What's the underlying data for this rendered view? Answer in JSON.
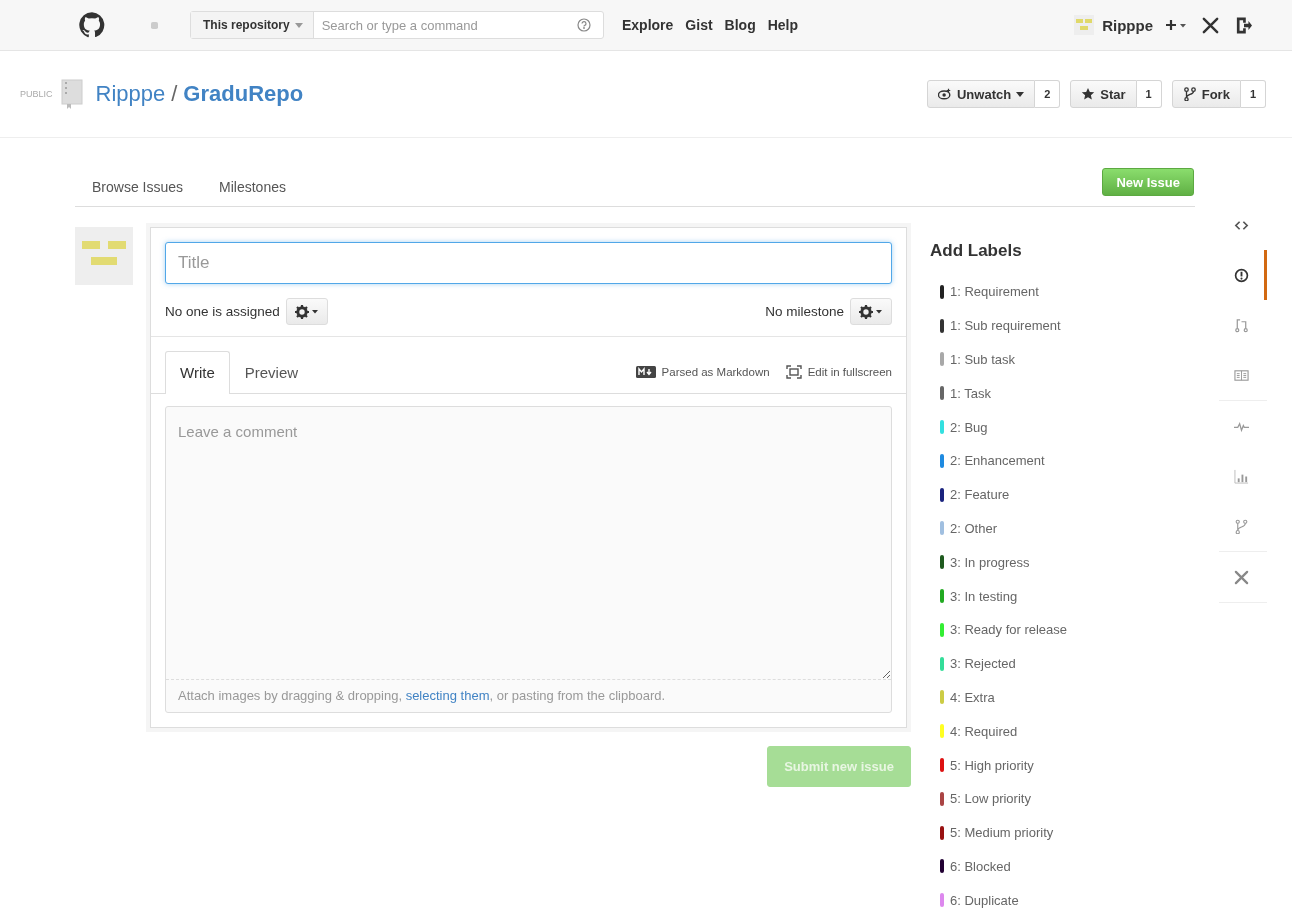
{
  "header": {
    "scope": "This repository",
    "search_placeholder": "Search or type a command",
    "nav": [
      "Explore",
      "Gist",
      "Blog",
      "Help"
    ],
    "user": "Ripppe"
  },
  "repo": {
    "visibility": "PUBLIC",
    "owner": "Ripppe",
    "separator": "/",
    "name": "GraduRepo",
    "actions": [
      {
        "kind": "watch",
        "label": "Unwatch",
        "count": "2"
      },
      {
        "kind": "star",
        "label": "Star",
        "count": "1"
      },
      {
        "kind": "fork",
        "label": "Fork",
        "count": "1"
      }
    ]
  },
  "subnav": {
    "links": [
      "Browse Issues",
      "Milestones"
    ],
    "new_button": "New Issue"
  },
  "form": {
    "title_placeholder": "Title",
    "assignee": "No one is assigned",
    "milestone": "No milestone",
    "tabs": [
      {
        "label": "Write",
        "selected": true
      },
      {
        "label": "Preview",
        "selected": false
      }
    ],
    "markdown_note": "Parsed as Markdown",
    "fullscreen": "Edit in fullscreen",
    "comment_placeholder": "Leave a comment",
    "attach_before": "Attach images by dragging & dropping,",
    "attach_link": "selecting them",
    "attach_after": ", or pasting from the clipboard.",
    "submit": {
      "label": "Submit new issue",
      "disabled": true
    }
  },
  "labels": {
    "title": "Add Labels",
    "items": [
      {
        "name": "1: Requirement",
        "color": "#222222"
      },
      {
        "name": "1: Sub requirement",
        "color": "#333333"
      },
      {
        "name": "1: Sub task",
        "color": "#a8a8a8"
      },
      {
        "name": "1: Task",
        "color": "#666666"
      },
      {
        "name": "2: Bug",
        "color": "#33e0e0"
      },
      {
        "name": "2: Enhancement",
        "color": "#1e8ae0"
      },
      {
        "name": "2: Feature",
        "color": "#1a237e"
      },
      {
        "name": "2: Other",
        "color": "#a0bfe0"
      },
      {
        "name": "3: In progress",
        "color": "#1e5a1e"
      },
      {
        "name": "3: In testing",
        "color": "#22aa22"
      },
      {
        "name": "3: Ready for release",
        "color": "#33ee33"
      },
      {
        "name": "3: Rejected",
        "color": "#33dd99"
      },
      {
        "name": "4: Extra",
        "color": "#cccc44"
      },
      {
        "name": "4: Required",
        "color": "#ffff22"
      },
      {
        "name": "5: High priority",
        "color": "#dd1111"
      },
      {
        "name": "5: Low priority",
        "color": "#aa4444"
      },
      {
        "name": "5: Medium priority",
        "color": "#991111"
      },
      {
        "name": "6: Blocked",
        "color": "#220033"
      },
      {
        "name": "6: Duplicate",
        "color": "#dd88ee"
      }
    ]
  },
  "sidenav": {
    "groups": [
      {
        "items": [
          {
            "kind": "code",
            "selected": false
          },
          {
            "kind": "issues",
            "selected": true
          },
          {
            "kind": "pulls",
            "selected": false
          },
          {
            "kind": "wiki",
            "selected": false
          }
        ]
      },
      {
        "items": [
          {
            "kind": "pulse",
            "selected": false
          },
          {
            "kind": "graphs",
            "selected": false
          },
          {
            "kind": "network",
            "selected": false
          }
        ]
      },
      {
        "items": [
          {
            "kind": "settings",
            "selected": false
          }
        ]
      }
    ]
  }
}
